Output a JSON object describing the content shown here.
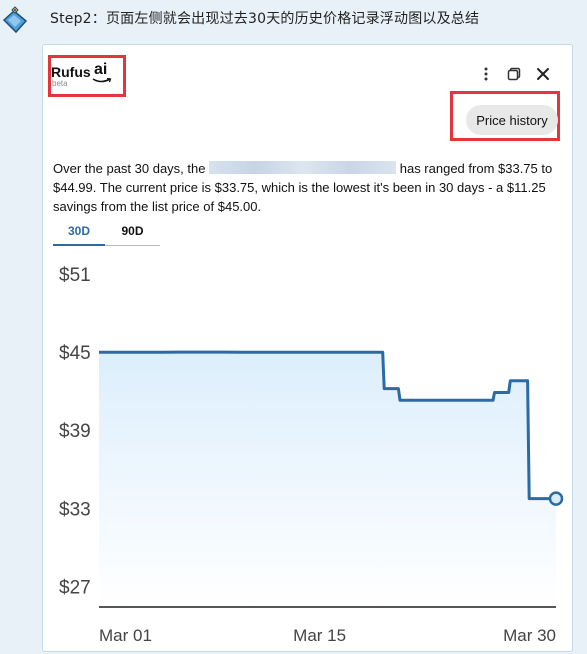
{
  "step": {
    "text": "Step2：页面左侧就会出现过去30天的历史价格记录浮动图以及总结",
    "icon": "paint-brush-icon"
  },
  "rufus": {
    "logo_name": "Rufus",
    "logo_ai": "ai",
    "beta": "beta"
  },
  "toolbar": {
    "icons": [
      "more-vertical-icon",
      "pop-out-icon",
      "close-icon"
    ]
  },
  "price_history_button": "Price history",
  "summary": {
    "part1": "Over the past 30 days, the",
    "part2": "has ranged from $33.75 to $44.99. The current price is $33.75, which is the lowest it's been in 30 days - a $11.25 savings from the list price of $45.00."
  },
  "tabs": [
    {
      "label": "30D",
      "active": true
    },
    {
      "label": "90D",
      "active": false
    }
  ],
  "colors": {
    "accent": "#2c6aa4",
    "highlight_box": "#e4353c",
    "area_fill": "#dceefc"
  },
  "chart_data": {
    "type": "line",
    "y_ticks": [
      "$51",
      "$45",
      "$39",
      "$33",
      "$27"
    ],
    "y_tick_values": [
      51,
      45,
      39,
      33,
      27
    ],
    "x_ticks": [
      "Mar 01",
      "Mar 15",
      "Mar 30"
    ],
    "x_tick_values": [
      1,
      15,
      30
    ],
    "ylim": [
      25.5,
      52
    ],
    "xlim": [
      1,
      30
    ],
    "grid": false,
    "series": [
      {
        "points": [
          [
            1,
            44.99
          ],
          [
            5,
            44.99
          ],
          [
            6,
            45.0
          ],
          [
            9,
            45.0
          ],
          [
            10,
            44.99
          ],
          [
            19,
            44.99
          ],
          [
            19.1,
            42.2
          ],
          [
            20,
            42.2
          ],
          [
            20.1,
            41.3
          ],
          [
            26,
            41.3
          ],
          [
            26.1,
            41.9
          ],
          [
            27,
            41.9
          ],
          [
            27.1,
            42.8
          ],
          [
            28.2,
            42.8
          ],
          [
            28.3,
            33.75
          ],
          [
            30,
            33.75
          ]
        ]
      }
    ]
  }
}
